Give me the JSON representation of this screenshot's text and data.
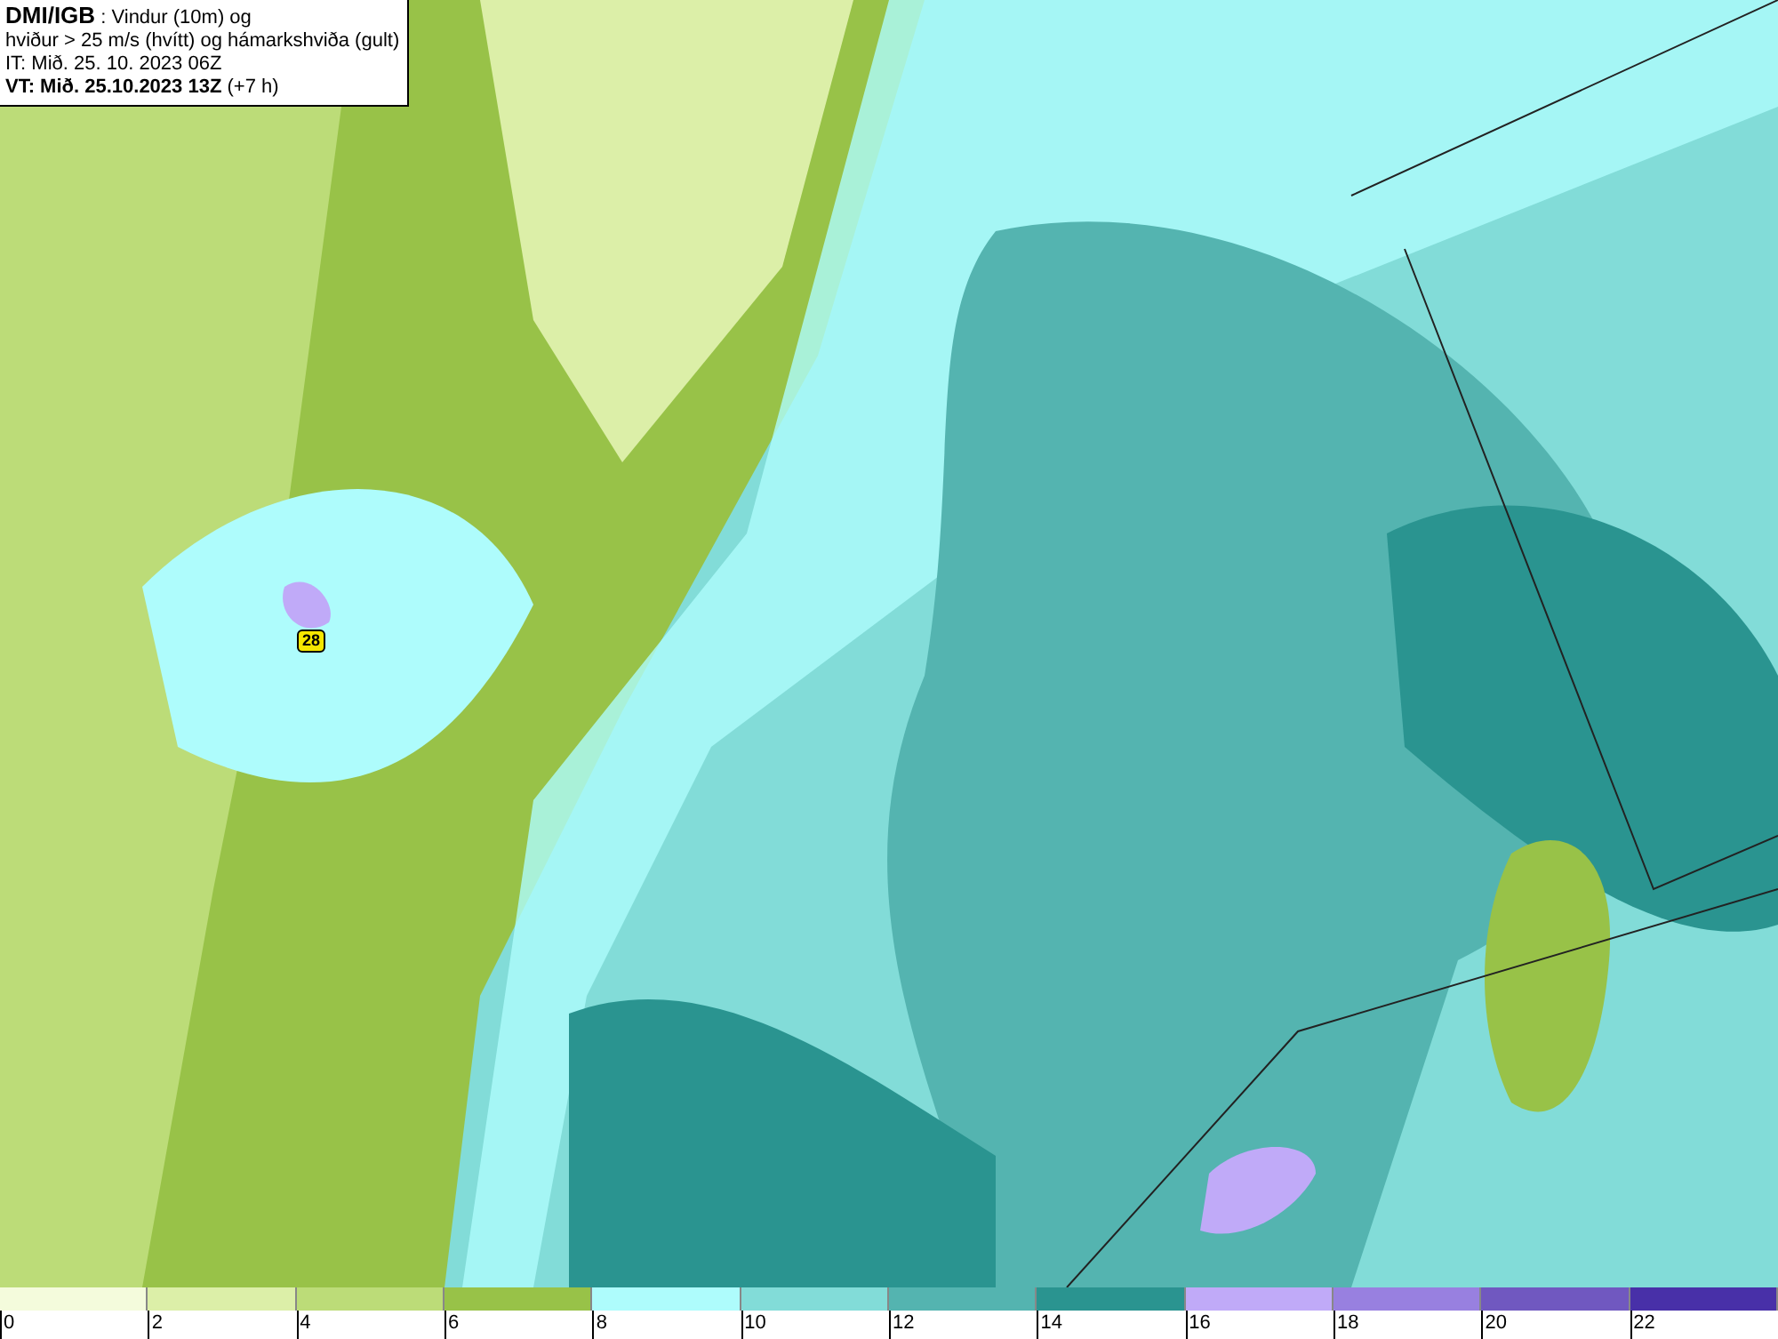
{
  "info_box": {
    "lines": [
      "**DMI/IGB** : Vindur (10m) og",
      "hviður > 25 m/s (hvítt) og hámarkshviða (gult)",
      "IT: Mið. 25. 10. 2023 06Z",
      "**VT: Mið. 25.10.2023 13Z** (+7 h)"
    ]
  },
  "map": {
    "gust_marker": "28"
  },
  "legend": {
    "segments": [
      {
        "color": "#f4fbdc"
      },
      {
        "color": "#dcefa8"
      },
      {
        "color": "#bcdc78"
      },
      {
        "color": "#98c248"
      },
      {
        "color": "#aefcfc"
      },
      {
        "color": "#82dcd8"
      },
      {
        "color": "#54b4b0"
      },
      {
        "color": "#2a9490"
      },
      {
        "color": "#c0aaf8"
      },
      {
        "color": "#9880e0"
      },
      {
        "color": "#7058c0"
      },
      {
        "color": "#4830a8"
      }
    ],
    "labels": [
      "0",
      "2",
      "4",
      "6",
      "8",
      "10",
      "12",
      "14",
      "16",
      "18",
      "20",
      "22"
    ]
  }
}
